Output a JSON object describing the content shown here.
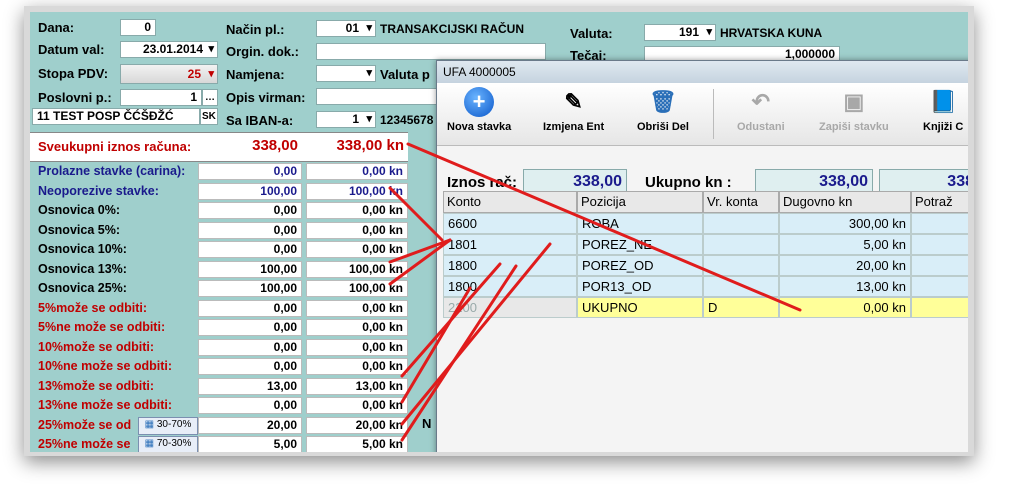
{
  "form": {
    "dana_label": "Dana:",
    "dana_value": "0",
    "datum_label": "Datum val:",
    "datum_value": "23.01.2014",
    "stopa_label": "Stopa PDV:",
    "stopa_value": "25",
    "poslovni_label": "Poslovni p.:",
    "poslovni_value": "1",
    "partner_value": "11 TEST POSP ČĆŠĐŽĆ",
    "sk_label": "SK",
    "nacin_label": "Način pl.:",
    "nacin_code": "01",
    "nacin_value": "TRANSAKCIJSKI RAČUN",
    "orgin_label": "Orgin. dok.:",
    "namjena_label": "Namjena:",
    "valuta_p_label": "Valuta p",
    "opis_label": "Opis virman:",
    "iban_label": "Sa IBAN-a:",
    "iban_code": "1",
    "iban_value": "12345678",
    "valuta_label": "Valuta:",
    "valuta_code": "191",
    "valuta_value": "HRVATSKA KUNA",
    "tecaj_label": "Tečaj:",
    "tecaj_value": "1,000000",
    "n_label": "N"
  },
  "amounts": {
    "total_label": "Sveukupni iznos računa:",
    "total_v1": "338,00",
    "total_v2": "338,00 kn",
    "rows": [
      {
        "label": "Prolazne stavke (carina):",
        "v1": "0,00",
        "v2": "0,00 kn",
        "color": "blue"
      },
      {
        "label": "Neoporezive stavke:",
        "v1": "100,00",
        "v2": "100,00 kn",
        "color": "blue"
      },
      {
        "label": "Osnovica 0%:",
        "v1": "0,00",
        "v2": "0,00 kn",
        "color": "black"
      },
      {
        "label": "Osnovica 5%:",
        "v1": "0,00",
        "v2": "0,00 kn",
        "color": "black"
      },
      {
        "label": "Osnovica 10%:",
        "v1": "0,00",
        "v2": "0,00 kn",
        "color": "black"
      },
      {
        "label": "Osnovica 13%:",
        "v1": "100,00",
        "v2": "100,00 kn",
        "color": "black"
      },
      {
        "label": "Osnovica 25%:",
        "v1": "100,00",
        "v2": "100,00 kn",
        "color": "black"
      },
      {
        "label": "5%može se odbiti:",
        "v1": "0,00",
        "v2": "0,00 kn",
        "color": "red"
      },
      {
        "label": "5%ne može se odbiti:",
        "v1": "0,00",
        "v2": "0,00 kn",
        "color": "red"
      },
      {
        "label": "10%može se odbiti:",
        "v1": "0,00",
        "v2": "0,00 kn",
        "color": "red"
      },
      {
        "label": "10%ne može se odbiti:",
        "v1": "0,00",
        "v2": "0,00 kn",
        "color": "red"
      },
      {
        "label": "13%može se odbiti:",
        "v1": "13,00",
        "v2": "13,00 kn",
        "color": "red"
      },
      {
        "label": "13%ne može se odbiti:",
        "v1": "0,00",
        "v2": "0,00 kn",
        "color": "red"
      },
      {
        "label": "25%može se od",
        "v1": "20,00",
        "v2": "20,00 kn",
        "color": "red",
        "badge": "30-70%"
      },
      {
        "label": "25%ne može se",
        "v1": "5,00",
        "v2": "5,00 kn",
        "color": "red",
        "badge": "70-30%"
      }
    ]
  },
  "window": {
    "title": "UFA 4000005",
    "toolbar": [
      {
        "label": "Nova stavka",
        "icon": "plus-icon",
        "enabled": true
      },
      {
        "label": "Izmjena Ent",
        "icon": "edit-icon",
        "enabled": true
      },
      {
        "label": "Obriši Del",
        "icon": "trash-icon",
        "enabled": true
      },
      {
        "label": "Odustani",
        "icon": "undo-icon",
        "enabled": false
      },
      {
        "label": "Zapiši stavku",
        "icon": "save-icon",
        "enabled": false
      },
      {
        "label": "Knjiži C",
        "icon": "book-icon",
        "enabled": true
      }
    ],
    "iznos_label": "Iznos rač:",
    "iznos_value": "338,00",
    "ukupno_label": "Ukupno kn :",
    "ukupno_value": "338,00",
    "ukupno_value2": "338",
    "columns": [
      "Konto",
      "Pozicija",
      "Vr. konta",
      "Dugovno kn",
      "Potraž"
    ],
    "rows": [
      {
        "konto": "6600",
        "pozicija": "ROBA",
        "vr": "",
        "dug": "300,00 kn"
      },
      {
        "konto": "1801",
        "pozicija": "POREZ_NE",
        "vr": "",
        "dug": "5,00 kn"
      },
      {
        "konto": "1800",
        "pozicija": "POREZ_OD",
        "vr": "",
        "dug": "20,00 kn"
      },
      {
        "konto": "1800",
        "pozicija": "POR13_OD",
        "vr": "",
        "dug": "13,00 kn"
      },
      {
        "konto": "2200",
        "pozicija": "UKUPNO",
        "vr": "D",
        "dug": "0,00 kn"
      }
    ]
  },
  "colors": {
    "accent_red": "#c00000",
    "accent_blue": "#1a1a8c",
    "app_bg": "#9fcfcc",
    "highlight_row": "#ffff99"
  }
}
